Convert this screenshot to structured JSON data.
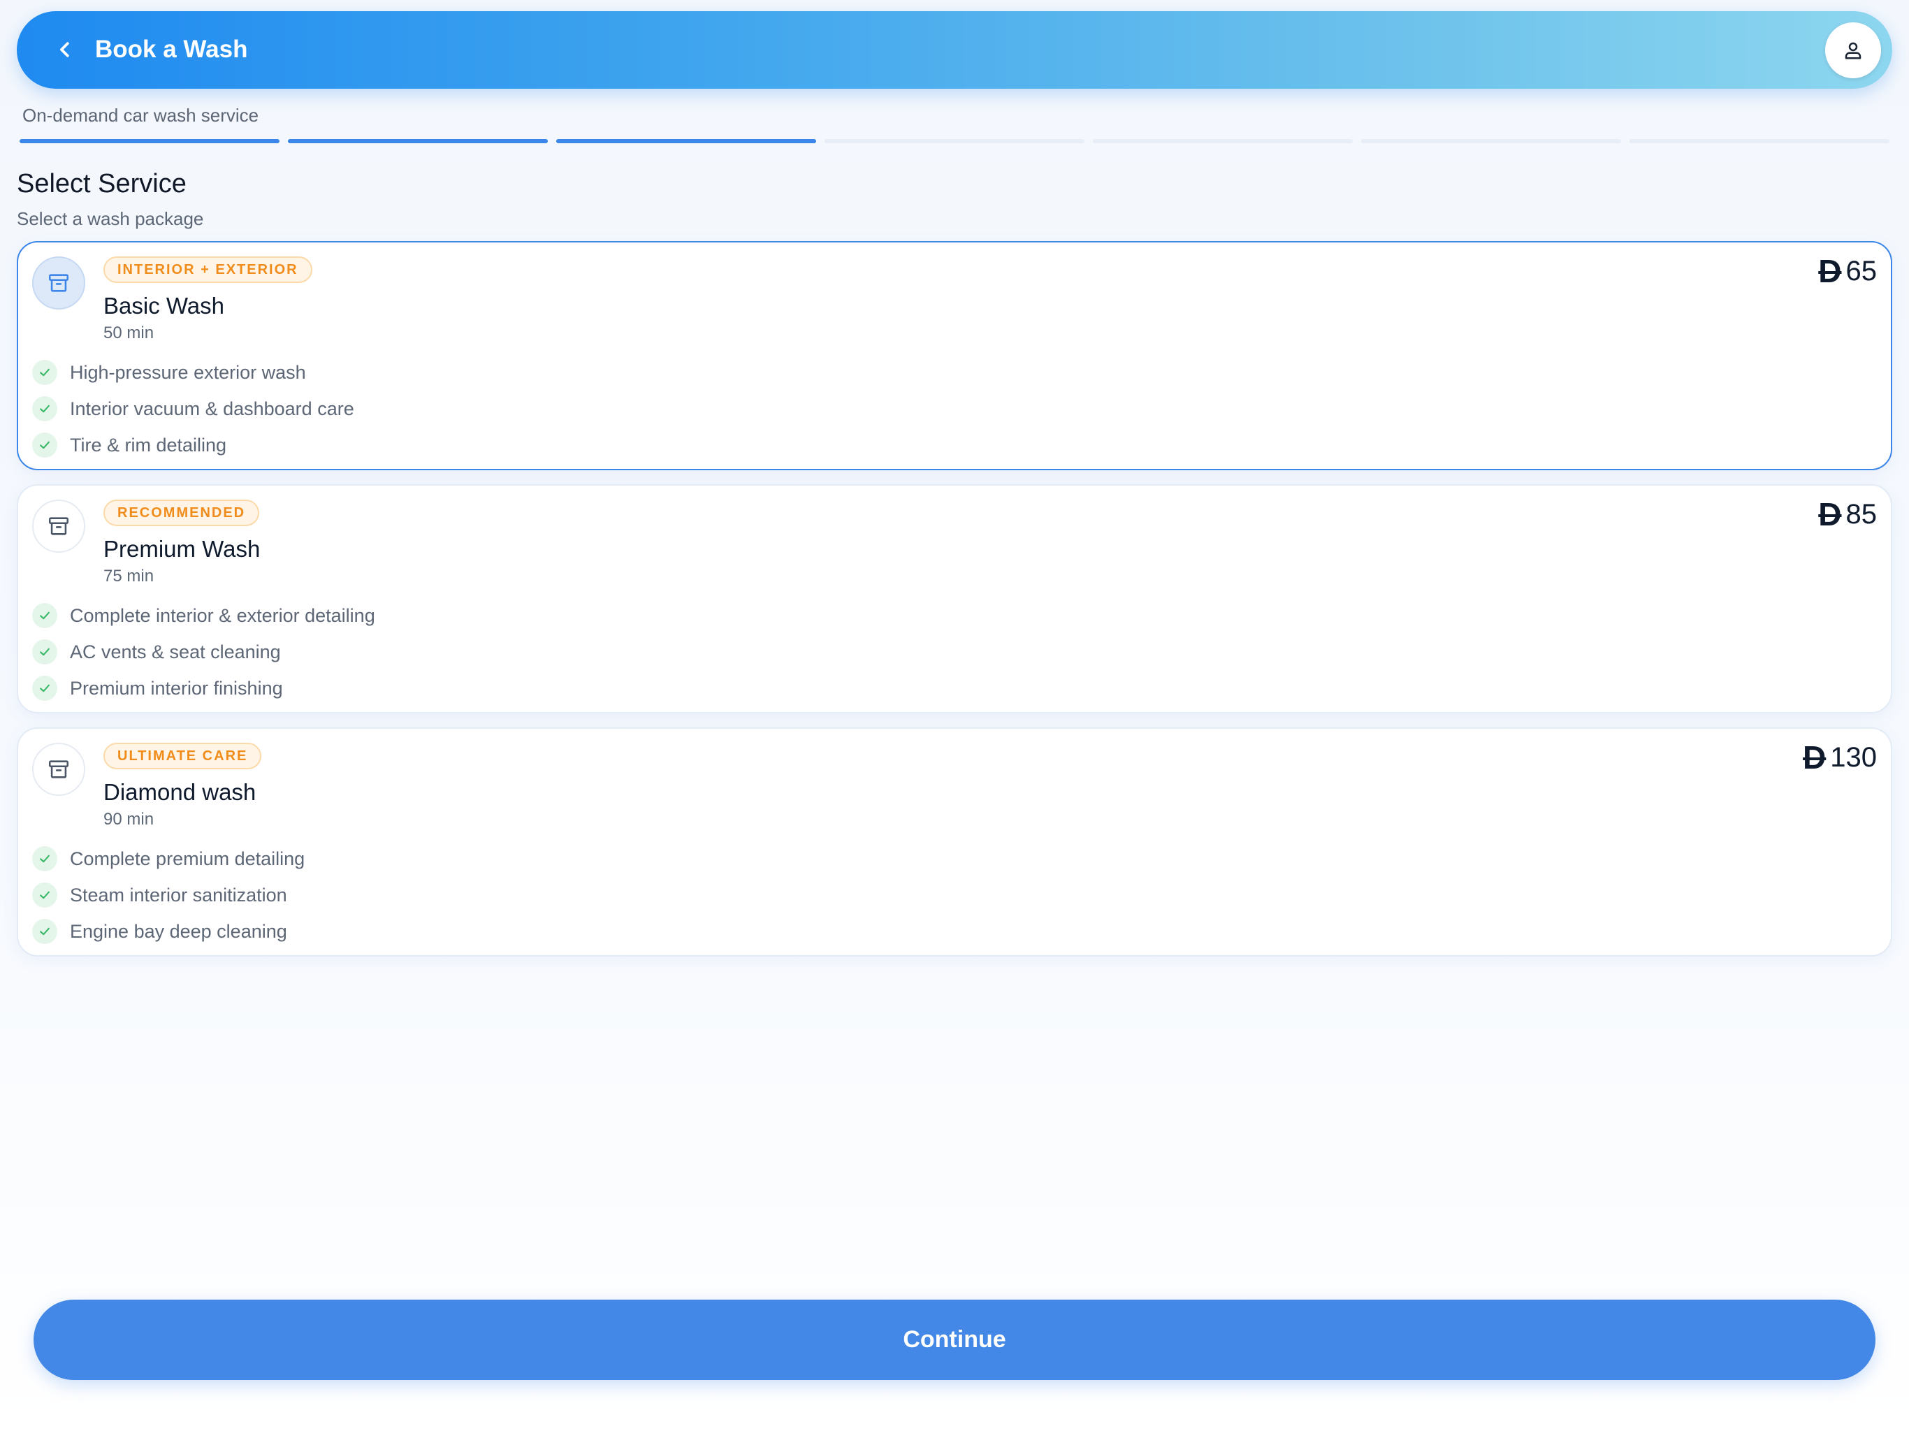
{
  "header": {
    "title": "Book a Wash",
    "back_icon": "chevron-left-icon",
    "profile_icon": "user-icon"
  },
  "subtitle": "On-demand car wash service",
  "progress": {
    "total_steps": 7,
    "completed_steps": 3,
    "active_color": "#3b86e8"
  },
  "section": {
    "title": "Select Service",
    "subtitle": "Select a wash package"
  },
  "currency_symbol": "D",
  "services": [
    {
      "badge": "INTERIOR + EXTERIOR",
      "name": "Basic Wash",
      "duration": "50 min",
      "price": "65",
      "selected": true,
      "features": [
        "High-pressure exterior wash",
        "Interior vacuum & dashboard care",
        "Tire & rim detailing"
      ]
    },
    {
      "badge": "RECOMMENDED",
      "name": "Premium Wash",
      "duration": "75 min",
      "price": "85",
      "selected": false,
      "features": [
        "Complete interior & exterior detailing",
        "AC vents & seat cleaning",
        "Premium interior finishing"
      ]
    },
    {
      "badge": "ULTIMATE CARE",
      "name": "Diamond wash",
      "duration": "90 min",
      "price": "130",
      "selected": false,
      "features": [
        "Complete premium detailing",
        "Steam interior sanitization",
        "Engine bay deep cleaning"
      ]
    }
  ],
  "continue_label": "Continue",
  "colors": {
    "accent": "#3b86e8",
    "badge_text": "#f08c1b",
    "check_green": "#3cb86a"
  }
}
